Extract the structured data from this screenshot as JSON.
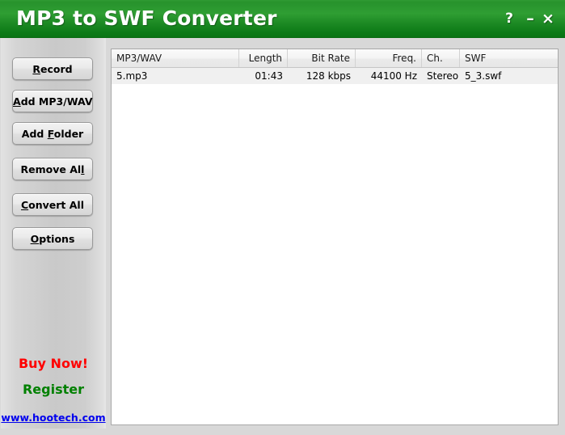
{
  "window": {
    "title": "MP3 to SWF Converter",
    "controls": [
      {
        "name": "help-button",
        "glyph": "?"
      },
      {
        "name": "minimize-button",
        "glyph": "–"
      },
      {
        "name": "close-button",
        "glyph": "×"
      }
    ]
  },
  "sidebar": {
    "buttons": [
      {
        "label": "Record",
        "accel_index": 0
      },
      {
        "label": "Add MP3/WAV",
        "accel_index": 0
      },
      {
        "label": "Add Folder",
        "accel_index": 4
      },
      {
        "label": "Remove All",
        "accel_index": 9
      },
      {
        "label": "Convert All",
        "accel_index": 0
      },
      {
        "label": "Options",
        "accel_index": 0
      }
    ],
    "buy_now": "Buy Now!",
    "register": "Register",
    "website": "www.hootech.com"
  },
  "list": {
    "columns": [
      {
        "label": "MP3/WAV",
        "align": "left"
      },
      {
        "label": "Length",
        "align": "right"
      },
      {
        "label": "Bit Rate",
        "align": "right"
      },
      {
        "label": "Freq.",
        "align": "right"
      },
      {
        "label": "Ch.",
        "align": "left"
      },
      {
        "label": "SWF",
        "align": "left"
      }
    ],
    "rows": [
      {
        "file": "5.mp3",
        "length": "01:43",
        "bit_rate": "128 kbps",
        "freq": "44100 Hz",
        "channels": "Stereo",
        "swf": "5_3.swf"
      }
    ]
  },
  "colors": {
    "title_bar_green": "#1d8a24",
    "buy_now_red": "#ff0000",
    "register_green": "#008000",
    "link_blue": "#0000ee"
  }
}
